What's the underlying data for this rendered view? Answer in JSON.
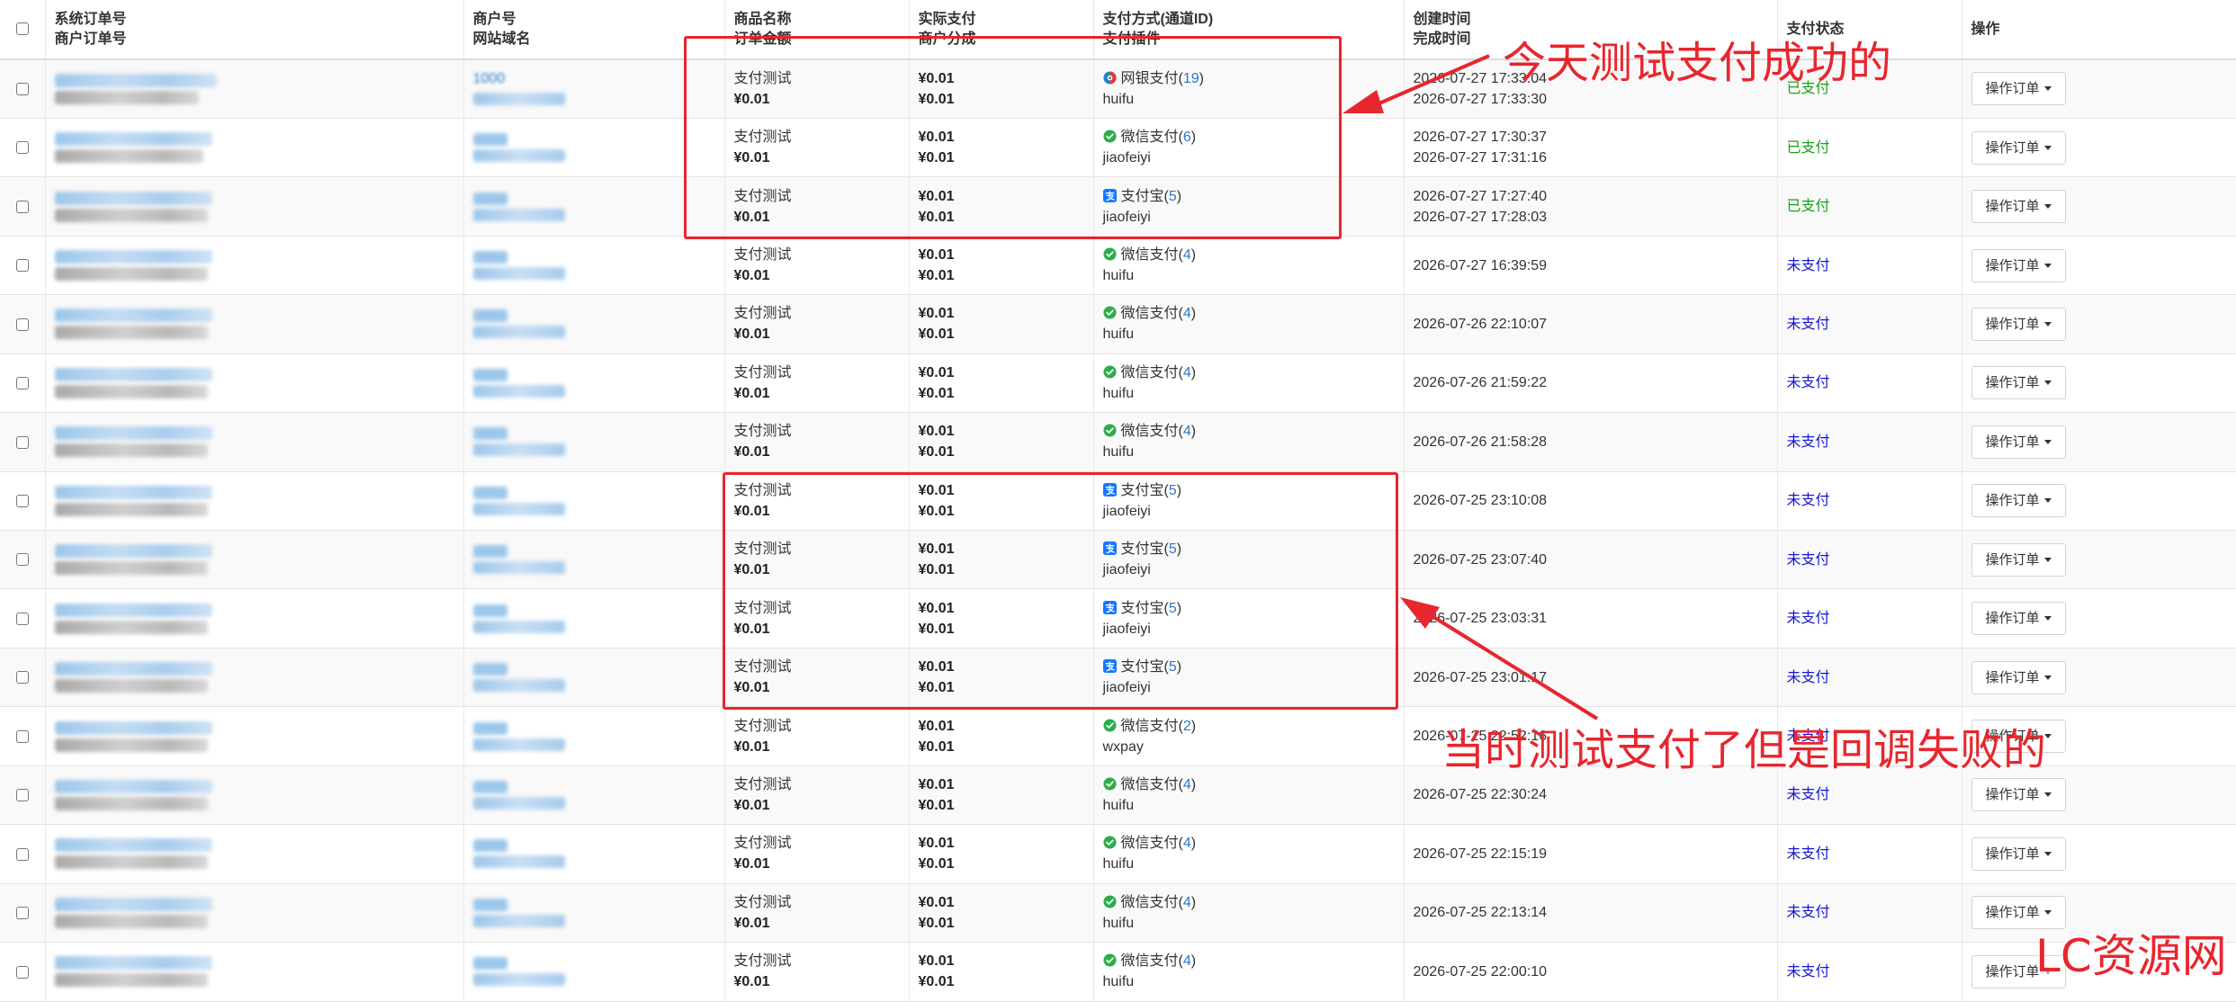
{
  "columns": {
    "order": [
      "系统订单号",
      "商户订单号"
    ],
    "merchant": [
      "商户号",
      "网站域名"
    ],
    "product": [
      "商品名称",
      "订单金额"
    ],
    "pay": [
      "实际支付",
      "商户分成"
    ],
    "method": [
      "支付方式(通道ID)",
      "支付插件"
    ],
    "time": [
      "创建时间",
      "完成时间"
    ],
    "status": "支付状态",
    "op": "操作"
  },
  "rows": [
    {
      "merchant_id": "1000",
      "product": "支付测试",
      "amount": "¥0.01",
      "paid": "¥0.01",
      "share": "¥0.01",
      "method": "网银支付",
      "channel_id": "19",
      "plugin": "huifu",
      "icon": "bank-icon",
      "created": "2026-07-27 17:33:04",
      "completed": "2026-07-27 17:33:30",
      "status": "已支付",
      "state": "paid"
    },
    {
      "product": "支付测试",
      "amount": "¥0.01",
      "paid": "¥0.01",
      "share": "¥0.01",
      "method": "微信支付",
      "channel_id": "6",
      "plugin": "jiaofeiyi",
      "icon": "wechat-icon",
      "created": "2026-07-27 17:30:37",
      "completed": "2026-07-27 17:31:16",
      "status": "已支付",
      "state": "paid"
    },
    {
      "product": "支付测试",
      "amount": "¥0.01",
      "paid": "¥0.01",
      "share": "¥0.01",
      "method": "支付宝",
      "channel_id": "5",
      "plugin": "jiaofeiyi",
      "icon": "alipay-icon",
      "created": "2026-07-27 17:27:40",
      "completed": "2026-07-27 17:28:03",
      "status": "已支付",
      "state": "paid"
    },
    {
      "product": "支付测试",
      "amount": "¥0.01",
      "paid": "¥0.01",
      "share": "¥0.01",
      "method": "微信支付",
      "channel_id": "4",
      "plugin": "huifu",
      "icon": "wechat-icon",
      "created": "2026-07-27 16:39:59",
      "completed": "",
      "status": "未支付",
      "state": "unpaid"
    },
    {
      "product": "支付测试",
      "amount": "¥0.01",
      "paid": "¥0.01",
      "share": "¥0.01",
      "method": "微信支付",
      "channel_id": "4",
      "plugin": "huifu",
      "icon": "wechat-icon",
      "created": "2026-07-26 22:10:07",
      "completed": "",
      "status": "未支付",
      "state": "unpaid"
    },
    {
      "product": "支付测试",
      "amount": "¥0.01",
      "paid": "¥0.01",
      "share": "¥0.01",
      "method": "微信支付",
      "channel_id": "4",
      "plugin": "huifu",
      "icon": "wechat-icon",
      "created": "2026-07-26 21:59:22",
      "completed": "",
      "status": "未支付",
      "state": "unpaid"
    },
    {
      "product": "支付测试",
      "amount": "¥0.01",
      "paid": "¥0.01",
      "share": "¥0.01",
      "method": "微信支付",
      "channel_id": "4",
      "plugin": "huifu",
      "icon": "wechat-icon",
      "created": "2026-07-26 21:58:28",
      "completed": "",
      "status": "未支付",
      "state": "unpaid"
    },
    {
      "product": "支付测试",
      "amount": "¥0.01",
      "paid": "¥0.01",
      "share": "¥0.01",
      "method": "支付宝",
      "channel_id": "5",
      "plugin": "jiaofeiyi",
      "icon": "alipay-icon",
      "created": "2026-07-25 23:10:08",
      "completed": "",
      "status": "未支付",
      "state": "unpaid"
    },
    {
      "product": "支付测试",
      "amount": "¥0.01",
      "paid": "¥0.01",
      "share": "¥0.01",
      "method": "支付宝",
      "channel_id": "5",
      "plugin": "jiaofeiyi",
      "icon": "alipay-icon",
      "created": "2026-07-25 23:07:40",
      "completed": "",
      "status": "未支付",
      "state": "unpaid"
    },
    {
      "product": "支付测试",
      "amount": "¥0.01",
      "paid": "¥0.01",
      "share": "¥0.01",
      "method": "支付宝",
      "channel_id": "5",
      "plugin": "jiaofeiyi",
      "icon": "alipay-icon",
      "created": "2026-07-25 23:03:31",
      "completed": "",
      "status": "未支付",
      "state": "unpaid"
    },
    {
      "product": "支付测试",
      "amount": "¥0.01",
      "paid": "¥0.01",
      "share": "¥0.01",
      "method": "支付宝",
      "channel_id": "5",
      "plugin": "jiaofeiyi",
      "icon": "alipay-icon",
      "created": "2026-07-25 23:01:17",
      "completed": "",
      "status": "未支付",
      "state": "unpaid"
    },
    {
      "product": "支付测试",
      "amount": "¥0.01",
      "paid": "¥0.01",
      "share": "¥0.01",
      "method": "微信支付",
      "channel_id": "2",
      "plugin": "wxpay",
      "icon": "wechat-icon",
      "created": "2026-07-25 22:52:16",
      "completed": "",
      "status": "未支付",
      "state": "unpaid"
    },
    {
      "product": "支付测试",
      "amount": "¥0.01",
      "paid": "¥0.01",
      "share": "¥0.01",
      "method": "微信支付",
      "channel_id": "4",
      "plugin": "huifu",
      "icon": "wechat-icon",
      "created": "2026-07-25 22:30:24",
      "completed": "",
      "status": "未支付",
      "state": "unpaid"
    },
    {
      "product": "支付测试",
      "amount": "¥0.01",
      "paid": "¥0.01",
      "share": "¥0.01",
      "method": "微信支付",
      "channel_id": "4",
      "plugin": "huifu",
      "icon": "wechat-icon",
      "created": "2026-07-25 22:15:19",
      "completed": "",
      "status": "未支付",
      "state": "unpaid"
    },
    {
      "product": "支付测试",
      "amount": "¥0.01",
      "paid": "¥0.01",
      "share": "¥0.01",
      "method": "微信支付",
      "channel_id": "4",
      "plugin": "huifu",
      "icon": "wechat-icon",
      "created": "2026-07-25 22:13:14",
      "completed": "",
      "status": "未支付",
      "state": "unpaid"
    },
    {
      "product": "支付测试",
      "amount": "¥0.01",
      "paid": "¥0.01",
      "share": "¥0.01",
      "method": "微信支付",
      "channel_id": "4",
      "plugin": "huifu",
      "icon": "wechat-icon",
      "created": "2026-07-25 22:00:10",
      "completed": "",
      "status": "未支付",
      "state": "unpaid"
    }
  ],
  "action_label": "操作订单",
  "annotations": {
    "top": "今天测试支付成功的",
    "bottom": "当时测试支付了但是回调失败的",
    "watermark": "LC资源网"
  },
  "colors": {
    "paid": "#18a018",
    "unpaid": "#1515d8",
    "annotation": "#e8262d",
    "channel_id": "#2a78c8"
  }
}
